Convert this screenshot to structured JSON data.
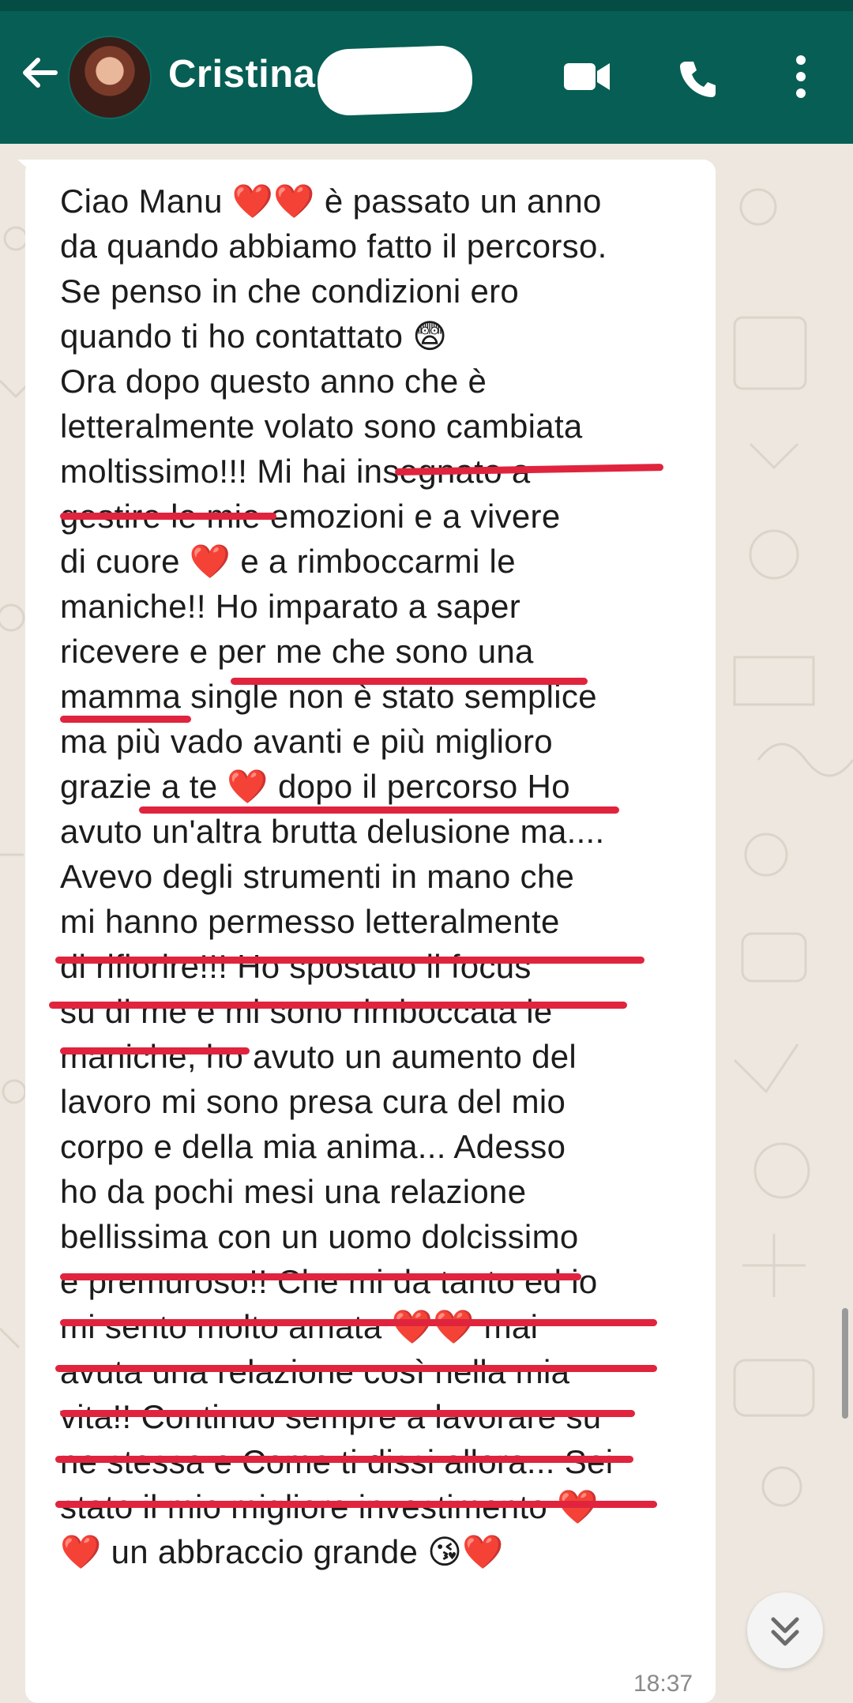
{
  "header": {
    "contact_name": "Cristina",
    "avatar": "contact-avatar"
  },
  "message": {
    "time": "18:37",
    "lines": [
      "Ciao Manu ❤️❤️ è passato un anno",
      "da quando abbiamo fatto il percorso.",
      "Se penso in che condizioni ero",
      "quando ti ho contattato 😨",
      "Ora dopo questo anno che è",
      "letteralmente volato sono cambiata",
      "moltissimo!!! Mi hai insegnato a",
      "gestire le mie emozioni e a vivere",
      "di cuore ❤️ e a rimboccarmi le",
      "maniche!! Ho imparato a saper",
      "ricevere e per me che sono una",
      "mamma single non è stato semplice",
      "ma più vado avanti e più miglioro",
      "grazie a te ❤️ dopo il percorso Ho",
      "avuto un'altra brutta delusione ma....",
      "Avevo degli strumenti in mano che",
      "mi hanno permesso letteralmente",
      "di rifiorire!!! Ho spostato il focus",
      "su di me e mi sono rimboccata le",
      "maniche, ho avuto un aumento del",
      "lavoro mi sono presa cura del mio",
      "corpo e della mia anima... Adesso",
      "ho da pochi mesi una relazione",
      "bellissima con un uomo dolcissimo",
      "e premuroso!! Che mi da tanto ed io",
      "mi sento molto amata ❤️❤️ mai",
      "avuta una relazione così nella mia",
      "vita!! Continuo sempre a lavorare su",
      "ne stessa e Come ti dissi allora... Sei",
      "stato il mio migliore investimento ❤️",
      "❤️ un abbraccio grande 😘❤️"
    ]
  },
  "colors": {
    "header": "#075e54",
    "underline": "#e0243e",
    "heart": "#e8141e"
  },
  "icons": [
    "back-arrow-icon",
    "video-call-icon",
    "phone-icon",
    "more-vert-icon",
    "scroll-down-icon"
  ]
}
